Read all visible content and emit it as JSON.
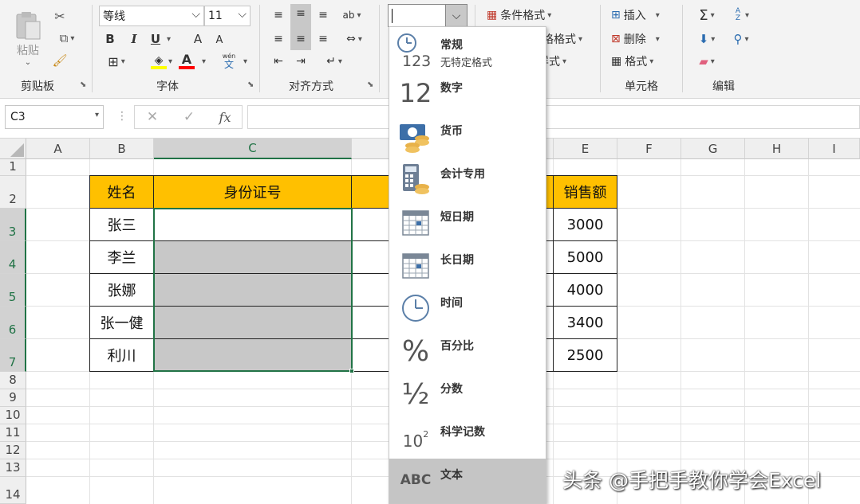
{
  "ribbon": {
    "clipboard": {
      "paste": "粘贴",
      "group": "剪贴板"
    },
    "font": {
      "name": "等线",
      "size": "11",
      "bold": "B",
      "italic": "I",
      "underline": "U",
      "grow": "A",
      "shrink": "A",
      "group": "字体",
      "pinyin": "wén",
      "pinyin_char": "文"
    },
    "align": {
      "group": "对齐方式",
      "orient": "ab"
    },
    "number": {
      "format_value": ""
    },
    "styles": {
      "cond_format": "条件格式",
      "table_format": "格格式",
      "cell_style": "样式"
    },
    "cells": {
      "insert": "插入",
      "delete": "删除",
      "format": "格式",
      "group": "单元格"
    },
    "editing": {
      "group": "编辑",
      "sort": "A Z"
    }
  },
  "formula_bar": {
    "name_box": "C3",
    "cancel": "✕",
    "enter": "✓",
    "fx": "fx",
    "value": ""
  },
  "columns": [
    "A",
    "B",
    "C",
    "",
    "E",
    "F",
    "G",
    "H",
    "I"
  ],
  "rows": [
    "1",
    "2",
    "3",
    "4",
    "5",
    "6",
    "7",
    "8",
    "9",
    "10",
    "11",
    "12",
    "13",
    "14"
  ],
  "table": {
    "headers": {
      "name": "姓名",
      "id": "身份证号",
      "sales": "销售额"
    },
    "names": [
      "张三",
      "李兰",
      "张娜",
      "张一健",
      "利川"
    ],
    "sales": [
      "3000",
      "5000",
      "4000",
      "3400",
      "2500"
    ]
  },
  "format_dropdown": {
    "items": [
      {
        "label": "常规",
        "sub": "无特定格式",
        "icon": "clock-123-icon",
        "glyph": "123"
      },
      {
        "label": "数字",
        "sub": "",
        "icon": "number-12-icon",
        "glyph": "12"
      },
      {
        "label": "货币",
        "sub": "",
        "icon": "currency-icon",
        "glyph": ""
      },
      {
        "label": "会计专用",
        "sub": "",
        "icon": "accounting-icon",
        "glyph": ""
      },
      {
        "label": "短日期",
        "sub": "",
        "icon": "short-date-icon",
        "glyph": ""
      },
      {
        "label": "长日期",
        "sub": "",
        "icon": "long-date-icon",
        "glyph": ""
      },
      {
        "label": "时间",
        "sub": "",
        "icon": "clock-icon",
        "glyph": ""
      },
      {
        "label": "百分比",
        "sub": "",
        "icon": "percent-icon",
        "glyph": "%"
      },
      {
        "label": "分数",
        "sub": "",
        "icon": "fraction-icon",
        "glyph": "½"
      },
      {
        "label": "科学记数",
        "sub": "",
        "icon": "scientific-icon",
        "glyph": "10",
        "sup": "2"
      },
      {
        "label": "文本",
        "sub": "",
        "icon": "text-abc-icon",
        "glyph": "ABC"
      }
    ]
  },
  "watermark": "头条 @手把手教你学会Excel",
  "colors": {
    "accent": "#217346",
    "header_fill": "#ffc000",
    "selection_fill": "#c8c8c8"
  }
}
